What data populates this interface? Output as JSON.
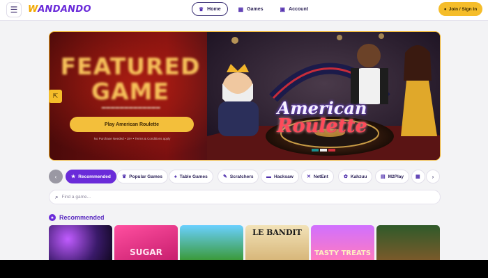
{
  "header": {
    "logo_prefix": "W",
    "logo_rest": "ANDANDO",
    "nav": [
      {
        "label": "Home",
        "icon": "crown-icon"
      },
      {
        "label": "Games",
        "icon": "games-icon"
      },
      {
        "label": "Account",
        "icon": "account-icon"
      }
    ],
    "join_label": "Join / Sign In"
  },
  "hero": {
    "title": "FEATURED GAME",
    "play_label": "Play American Roulette",
    "note": "No Purchase Needed • 18+ • Terms & Conditions apply",
    "game_logo_line1": "American",
    "game_logo_line2": "Roulette"
  },
  "categories": [
    {
      "label": "Recommended",
      "icon": "star-icon",
      "active": true
    },
    {
      "label": "Popular Games",
      "icon": "crown-icon"
    },
    {
      "label": "Table Games",
      "icon": "spade-icon"
    },
    {
      "label": "Scratchers",
      "icon": "scratch-icon"
    },
    {
      "label": "Hacksaw",
      "icon": "hacksaw-icon"
    },
    {
      "label": "NetEnt",
      "icon": "netent-icon"
    },
    {
      "label": "Kahzuu",
      "icon": "kahzuu-icon"
    },
    {
      "label": "M2Play",
      "icon": "m2play-icon"
    }
  ],
  "search": {
    "placeholder": "Find a game..."
  },
  "section": {
    "title": "Recommended",
    "tiles": [
      {
        "label": ""
      },
      {
        "label": "SUGAR"
      },
      {
        "label": ""
      },
      {
        "label": "LE BANDIT"
      },
      {
        "label": "TASTY TREATS"
      },
      {
        "label": ""
      }
    ]
  },
  "colors": {
    "brand_purple": "#6a2bd9",
    "accent_gold": "#f5bd2a"
  }
}
